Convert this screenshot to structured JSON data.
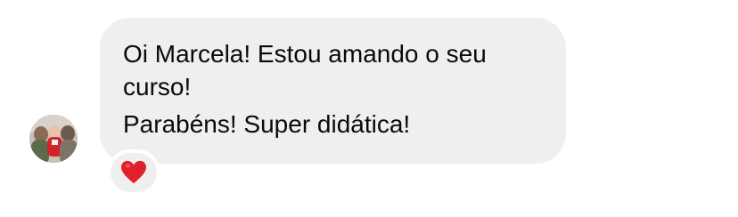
{
  "message": {
    "lines": [
      "Oi Marcela! Estou amando o seu",
      "curso!",
      "Parabéns! Super didática!"
    ],
    "bubble_color": "#efefef",
    "text_color": "#0a0a0a"
  },
  "reaction": {
    "icon": "red-heart-icon",
    "color": "#e0202c"
  },
  "sender": {
    "avatar_icon": "profile-photo"
  }
}
